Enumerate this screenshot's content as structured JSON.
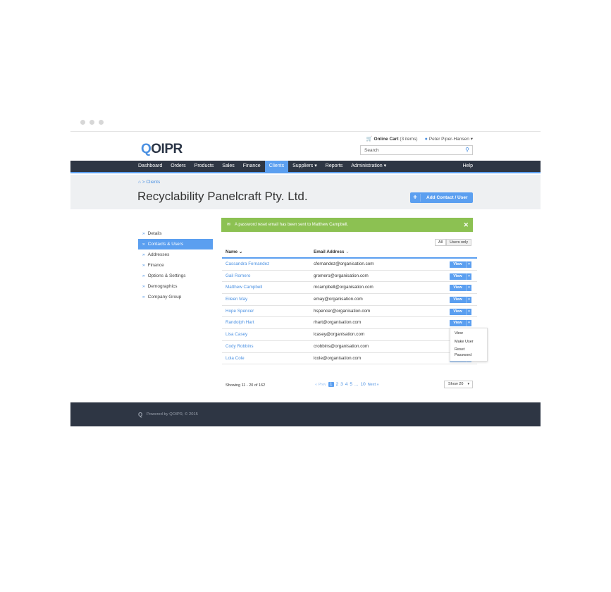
{
  "header": {
    "logo_q": "Q",
    "logo_rest": "OIPR",
    "cart_label": "Online Cart",
    "cart_count": "(3 items)",
    "user_name": "Peter Piper-Hansen",
    "search_placeholder": "Search"
  },
  "nav": {
    "items": [
      {
        "label": "Dashboard"
      },
      {
        "label": "Orders"
      },
      {
        "label": "Products"
      },
      {
        "label": "Sales"
      },
      {
        "label": "Finance"
      },
      {
        "label": "Clients"
      },
      {
        "label": "Suppliers ▾"
      },
      {
        "label": "Reports"
      },
      {
        "label": "Administration ▾"
      }
    ],
    "active": "Clients",
    "help": "Help"
  },
  "page": {
    "breadcrumb": "Clients",
    "title": "Recyclability Panelcraft Pty. Ltd.",
    "add_button": "Add Contact / User"
  },
  "sidebar": {
    "items": [
      {
        "label": "Details"
      },
      {
        "label": "Contacts & Users"
      },
      {
        "label": "Addresses"
      },
      {
        "label": "Finance"
      },
      {
        "label": "Options & Settings"
      },
      {
        "label": "Demographics"
      },
      {
        "label": "Company Group"
      }
    ],
    "active": "Contacts & Users"
  },
  "alert": {
    "message": "A password reset email has been sent to Matthew Campbell."
  },
  "filter": {
    "all": "All",
    "users_only": "Users only"
  },
  "table": {
    "columns": {
      "name": "Name",
      "email": "Email Address"
    },
    "rows": [
      {
        "name": "Cassandra Fernandez",
        "email": "cfernandez@organisation.com",
        "action": "View"
      },
      {
        "name": "Gail Romero",
        "email": "gromero@organisation.com",
        "action": "View"
      },
      {
        "name": "Matthew Campbell",
        "email": "mcampbell@organisation.com",
        "action": "View"
      },
      {
        "name": "Eileen May",
        "email": "emay@organisation.com",
        "action": "View"
      },
      {
        "name": "Hope Spencer",
        "email": "hspencer@organisation.com",
        "action": "View"
      },
      {
        "name": "Randolph Hart",
        "email": "rhart@organisation.com",
        "action": "View"
      },
      {
        "name": "Lisa Casey",
        "email": "lcasey@organisation.com",
        "action": ""
      },
      {
        "name": "Cody Robbins",
        "email": "crobbins@organisation.com",
        "action": ""
      },
      {
        "name": "Lola Cole",
        "email": "lcole@organisation.com",
        "action": "View"
      }
    ],
    "dropdown_menu": [
      "View",
      "Make User",
      "Reset Password"
    ]
  },
  "pagination": {
    "showing": "Showing 11 - 20 of 162",
    "prev": "« Prev",
    "pages": [
      "1",
      "2",
      "3",
      "4",
      "5",
      "...",
      "10"
    ],
    "current": "1",
    "next": "Next »",
    "show_select": "Show 20"
  },
  "footer": {
    "text": "Powered by QOIPR, © 2015"
  },
  "colors": {
    "accent": "#5b9ff0",
    "nav_bg": "#2e3644",
    "success": "#8cc152"
  }
}
